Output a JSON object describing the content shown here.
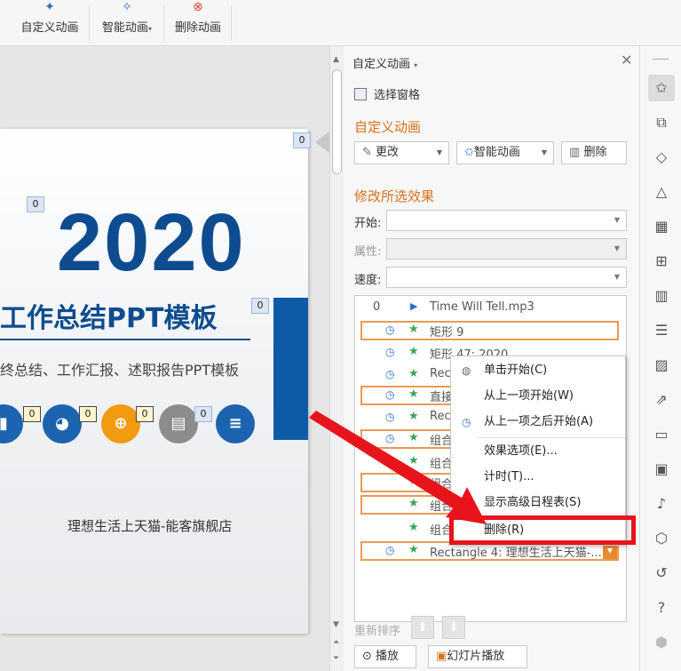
{
  "toolbar": {
    "buttons": [
      {
        "label": "自定义动画",
        "icon": "custom-animation-icon"
      },
      {
        "label": "智能动画",
        "icon": "smart-animation-icon",
        "has_dropdown": true
      },
      {
        "label": "删除动画",
        "icon": "delete-animation-icon"
      }
    ]
  },
  "slide": {
    "year": "2020",
    "title": "工作总结PPT模板",
    "subtitle": "终总结、工作汇报、述职报告PPT模板",
    "brand": "理想生活上天猫-能客旗舰店",
    "tags": [
      "0",
      "0",
      "0",
      "0",
      "0",
      "0",
      "0"
    ],
    "icons": [
      "bar-chart-icon",
      "pie-chart-icon",
      "zoom-in-icon",
      "notebook-icon",
      "notepad-icon"
    ]
  },
  "pane": {
    "title": "自定义动画",
    "select_pane": "选择窗格",
    "section_custom": "自定义动画",
    "change_btn": "更改",
    "smart_btn": "智能动画",
    "delete_btn": "删除",
    "section_modify": "修改所选效果",
    "start_label": "开始:",
    "property_label": "属性:",
    "speed_label": "速度:",
    "items": [
      {
        "num": "0",
        "label": "Time Will Tell.mp3",
        "type": "sound"
      },
      {
        "label": "矩形 9",
        "boxed": true
      },
      {
        "label": "矩形 47: 2020"
      },
      {
        "label": "Rec",
        "boxed": false
      },
      {
        "label": "直接",
        "boxed": true
      },
      {
        "label": "Rec"
      },
      {
        "label": "组合",
        "boxed": true
      },
      {
        "label": "组合"
      },
      {
        "label": "组合",
        "boxed": true
      },
      {
        "label": "组合",
        "boxed": true
      },
      {
        "label": "组合"
      },
      {
        "label": "Rectangle 4: 理想生活上天猫-...",
        "boxed": true
      }
    ],
    "reorder": "重新排序",
    "play_btn": "播放",
    "slideshow_btn": "幻灯片播放"
  },
  "context_menu": {
    "items": [
      {
        "label": "单击开始(C)",
        "icon": "mouse-icon"
      },
      {
        "label": "从上一项开始(W)"
      },
      {
        "label": "从上一项之后开始(A)",
        "icon": "clock-icon"
      },
      {
        "label": "效果选项(E)..."
      },
      {
        "label": "计时(T)..."
      },
      {
        "label": "显示高级日程表(S)"
      },
      {
        "label": "删除(R)",
        "highlighted": true
      }
    ]
  },
  "sidebar": {
    "icons": [
      "animation-star-icon",
      "transition-icon",
      "shapes-icon",
      "layers-icon",
      "table-icon",
      "grid-icon",
      "chart-icon",
      "settings-icon",
      "picture-icon",
      "share-icon",
      "archive-icon",
      "image-icon",
      "audio-icon",
      "shield-icon",
      "history-icon",
      "help-icon",
      "cube-icon"
    ]
  },
  "colors": {
    "accent_orange": "#d6711c",
    "highlight_red": "#e8141c",
    "slide_blue": "#0e4c8f"
  }
}
